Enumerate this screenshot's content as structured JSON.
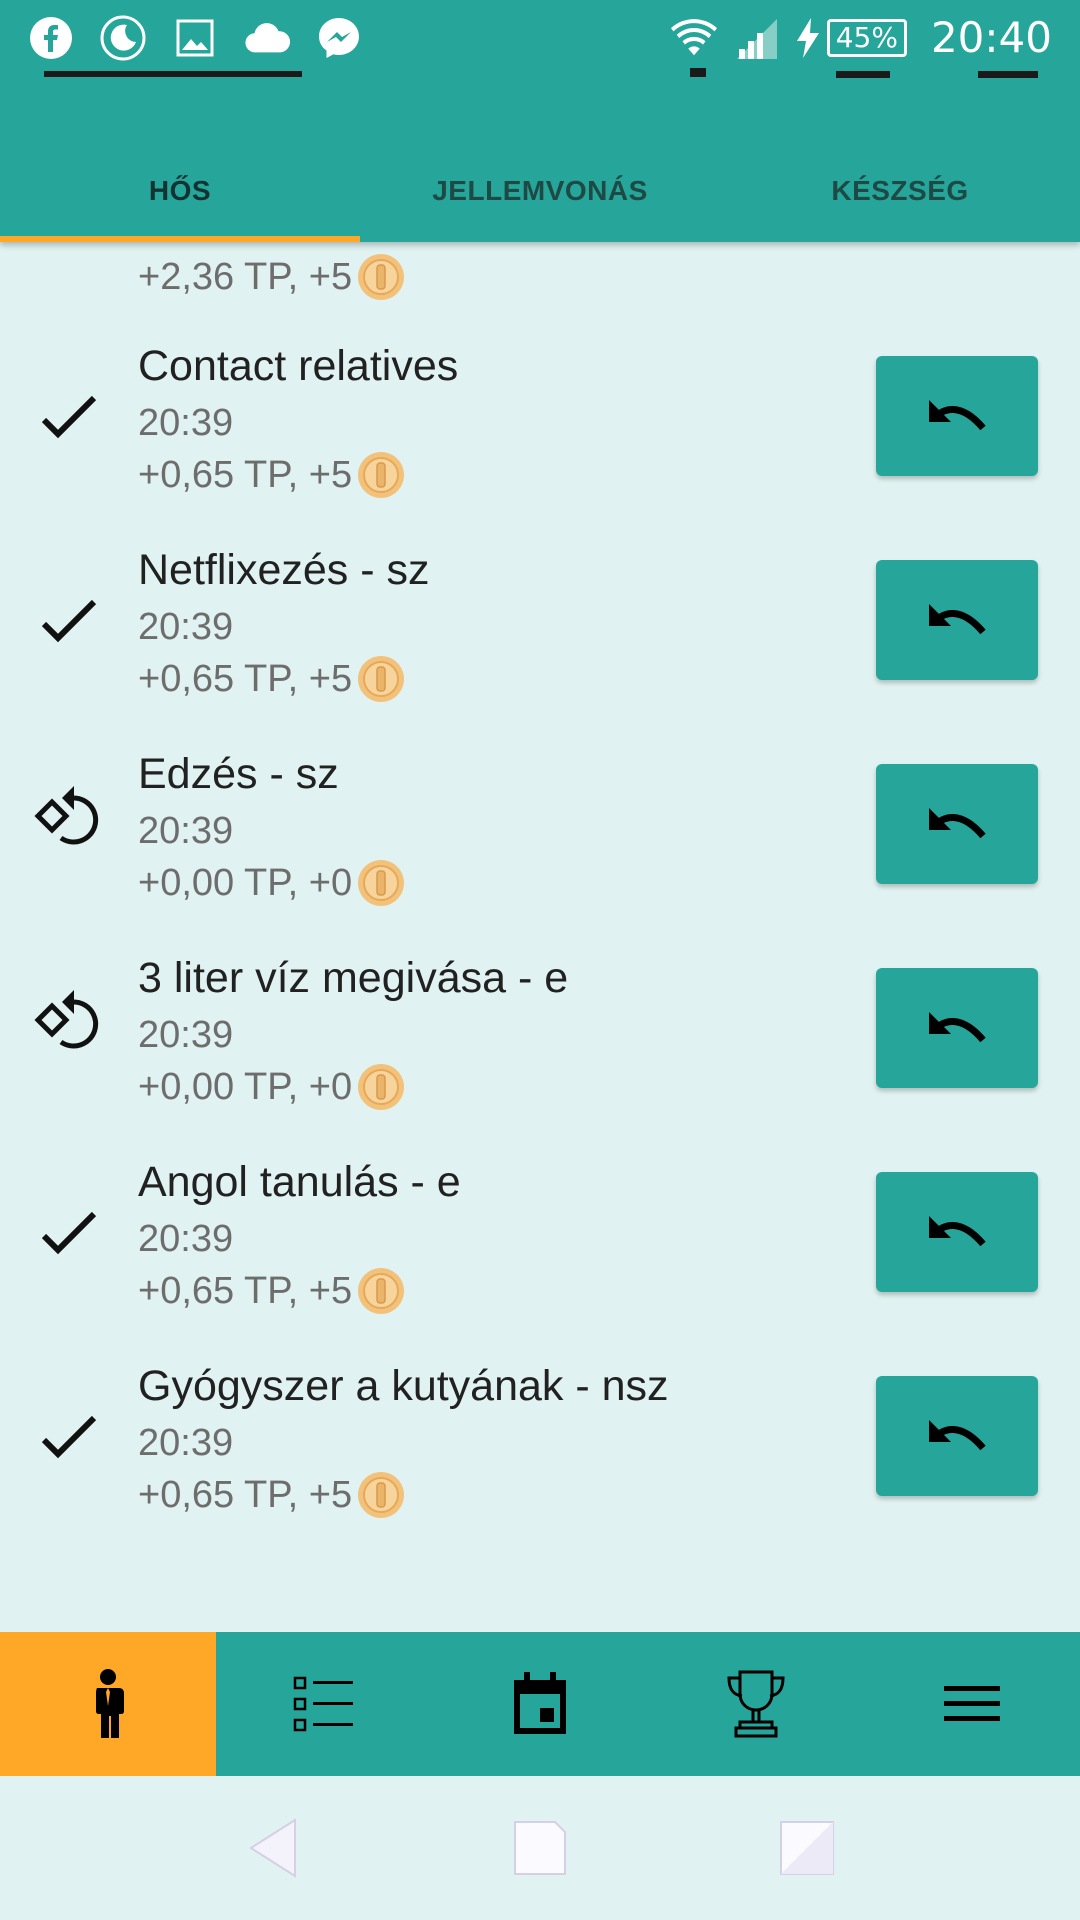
{
  "status_bar": {
    "left_icons": [
      "facebook-icon",
      "moon-icon",
      "gallery-icon",
      "cloud-icon",
      "messenger-icon"
    ],
    "battery": "45%",
    "time": "20:40"
  },
  "tabs": [
    {
      "label": "HŐS",
      "active": true
    },
    {
      "label": "JELLEMVONÁS",
      "active": false
    },
    {
      "label": "KÉSZSÉG",
      "active": false
    }
  ],
  "partial_row": {
    "reward": "+2,36 TP, +5"
  },
  "rows": [
    {
      "status": "done",
      "title": "Contact relatives",
      "time": "20:39",
      "reward": "+0,65 TP, +5"
    },
    {
      "status": "done",
      "title": "Netflixezés - sz",
      "time": "20:39",
      "reward": "+0,65 TP, +5"
    },
    {
      "status": "skipped",
      "title": "Edzés - sz",
      "time": "20:39",
      "reward": "+0,00 TP, +0"
    },
    {
      "status": "skipped",
      "title": "3 liter víz megivása - e",
      "time": "20:39",
      "reward": "+0,00 TP, +0"
    },
    {
      "status": "done",
      "title": "Angol tanulás - e",
      "time": "20:39",
      "reward": "+0,65 TP, +5"
    },
    {
      "status": "done",
      "title": "Gyógyszer a kutyának - nsz",
      "time": "20:39",
      "reward": "+0,65 TP, +5"
    }
  ],
  "bottom_nav": [
    {
      "icon": "hero-person-icon",
      "active": true
    },
    {
      "icon": "checklist-icon",
      "active": false
    },
    {
      "icon": "calendar-icon",
      "active": false
    },
    {
      "icon": "trophy-icon",
      "active": false
    },
    {
      "icon": "menu-icon",
      "active": false
    }
  ],
  "colors": {
    "primary": "#26a69a",
    "accent": "#ffa726",
    "background": "#e0f2f1"
  }
}
